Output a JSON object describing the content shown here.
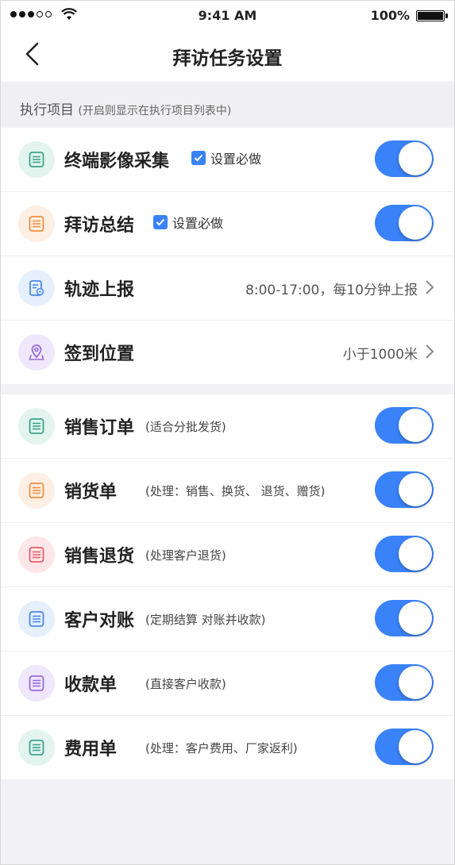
{
  "status_bar": {
    "time": "9:41 AM",
    "battery": "100%"
  },
  "navbar": {
    "title": "拜访任务设置"
  },
  "section_header": {
    "title": "执行项目",
    "note": "(开启则显示在执行项目列表中)"
  },
  "execution_items": [
    {
      "title": "终端影像采集",
      "checkbox_label": "设置必做",
      "checked": true,
      "enabled": true,
      "icon": "list-icon",
      "color": "#3aa58a",
      "bg": "#e3f4ef"
    },
    {
      "title": "拜访总结",
      "checkbox_label": "设置必做",
      "checked": true,
      "enabled": true,
      "icon": "list-icon",
      "color": "#f29141",
      "bg": "#fdefe3"
    },
    {
      "title": "轨迹上报",
      "value": "8:00-17:00，每10分钟上报",
      "icon": "track-report-icon",
      "color": "#4a8ae8",
      "bg": "#e6effc"
    },
    {
      "title": "签到位置",
      "value": "小于1000米",
      "icon": "location-icon",
      "color": "#9a6bdc",
      "bg": "#efe7fb"
    }
  ],
  "documents": [
    {
      "title": "销售订单",
      "note": "(适合分批发货)",
      "enabled": true,
      "icon": "list-icon",
      "color": "#3aa58a",
      "bg": "#e3f4ef"
    },
    {
      "title": "销货单",
      "note": "(处理：销售、换货、 退货、赠货)",
      "enabled": true,
      "icon": "list-icon",
      "color": "#f29141",
      "bg": "#fdefe3"
    },
    {
      "title": "销售退货",
      "note": "(处理客户退货)",
      "enabled": true,
      "icon": "list-icon",
      "color": "#e85d6a",
      "bg": "#fde6e8"
    },
    {
      "title": "客户对账",
      "note": "(定期结算 对账并收款)",
      "enabled": true,
      "icon": "list-icon",
      "color": "#4a8ae8",
      "bg": "#e6effc"
    },
    {
      "title": "收款单",
      "note": "(直接客户收款)",
      "enabled": true,
      "icon": "list-icon",
      "color": "#9a6bdc",
      "bg": "#efe7fb"
    },
    {
      "title": "费用单",
      "note": "(处理：客户费用、厂家返利)",
      "enabled": true,
      "icon": "list-icon",
      "color": "#3aa58a",
      "bg": "#e3f4ef"
    }
  ],
  "colors": {
    "accent": "#3a82f7"
  }
}
